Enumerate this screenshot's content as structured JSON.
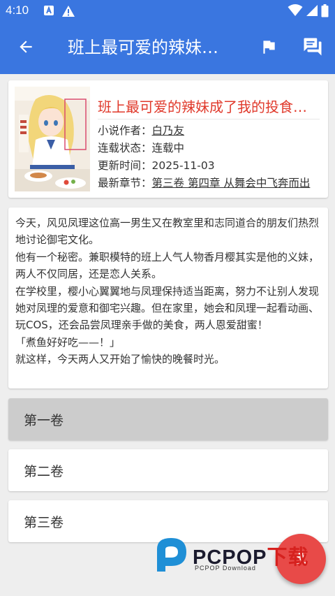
{
  "status_bar": {
    "time": "4:10"
  },
  "app_bar": {
    "title": "班上最可爱的辣妹…",
    "back_icon": "arrow-left-icon",
    "flag_icon": "flag-icon",
    "comment_icon": "comment-icon",
    "color": "#3a76e0"
  },
  "book": {
    "title": "班上最可爱的辣妹成了我的投食…",
    "author_label": "小说作者：",
    "author": "白乃友",
    "status_label": "连载状态：",
    "status": "连载中",
    "updated_label": "更新时间：",
    "updated": "2025-11-03",
    "latest_label": "最新章节：",
    "latest_chapter": "第三卷 第四章 从舞会中飞奔而出",
    "title_color": "#e0392b"
  },
  "description": [
    "今天，风见凤理这位高一男生又在教室里和志同道合的朋友们热烈地讨论御宅文化。",
    "他有一个秘密。兼职模特的班上人气人物香月樱其实是他的义妹，两人不仅同居，还是恋人关系。",
    "在学校里，樱小心翼翼地与凤理保持适当距离，努力不让别人发现她对凤理的爱意和御宅兴趣。但在家里，她会和凤理一起看动画、玩COS，还会品尝凤理亲手做的美食，两人恩爱甜蜜！",
    "「煮鱼好好吃——！」",
    "就这样，今天两人又开始了愉快的晚餐时光。"
  ],
  "volumes": [
    {
      "label": "第一卷"
    },
    {
      "label": "第二卷"
    },
    {
      "label": "第三卷"
    }
  ],
  "fab": {
    "icon": "download-icon",
    "color": "#e84a48"
  },
  "watermark": {
    "brand": "PCPOP",
    "brand_cn": "下载",
    "sub": "PCPOP Download"
  }
}
